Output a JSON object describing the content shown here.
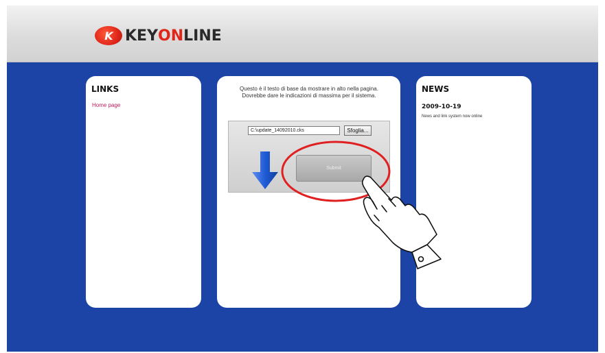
{
  "header": {
    "logo_mark": "K",
    "logo_word_1": "KEY",
    "logo_word_2": "ON",
    "logo_word_3": "LINE"
  },
  "links_panel": {
    "title": "LINKS",
    "items": [
      {
        "label": "Home page"
      }
    ]
  },
  "main_panel": {
    "intro_line_1": "Questo è il testo di base da mostrare in alto nella pagina.",
    "intro_line_2": "Dovrebbe dare le indicazioni di massima per il sistema.",
    "file_input_value": "C:\\update_14092010.cks",
    "browse_label": "Sfoglia...",
    "submit_label": "Submit"
  },
  "news_panel": {
    "title": "NEWS",
    "date": "2009-10-19",
    "text": "News and link system now online"
  },
  "colors": {
    "background_blue": "#1b44a6",
    "brand_red": "#e0261a",
    "link_color": "#c2185b",
    "annotation_red": "#e02020",
    "arrow_blue": "#1f5bd6"
  },
  "icons": {
    "arrow": "arrow-down-icon",
    "pointer": "pointing-hand-icon"
  }
}
